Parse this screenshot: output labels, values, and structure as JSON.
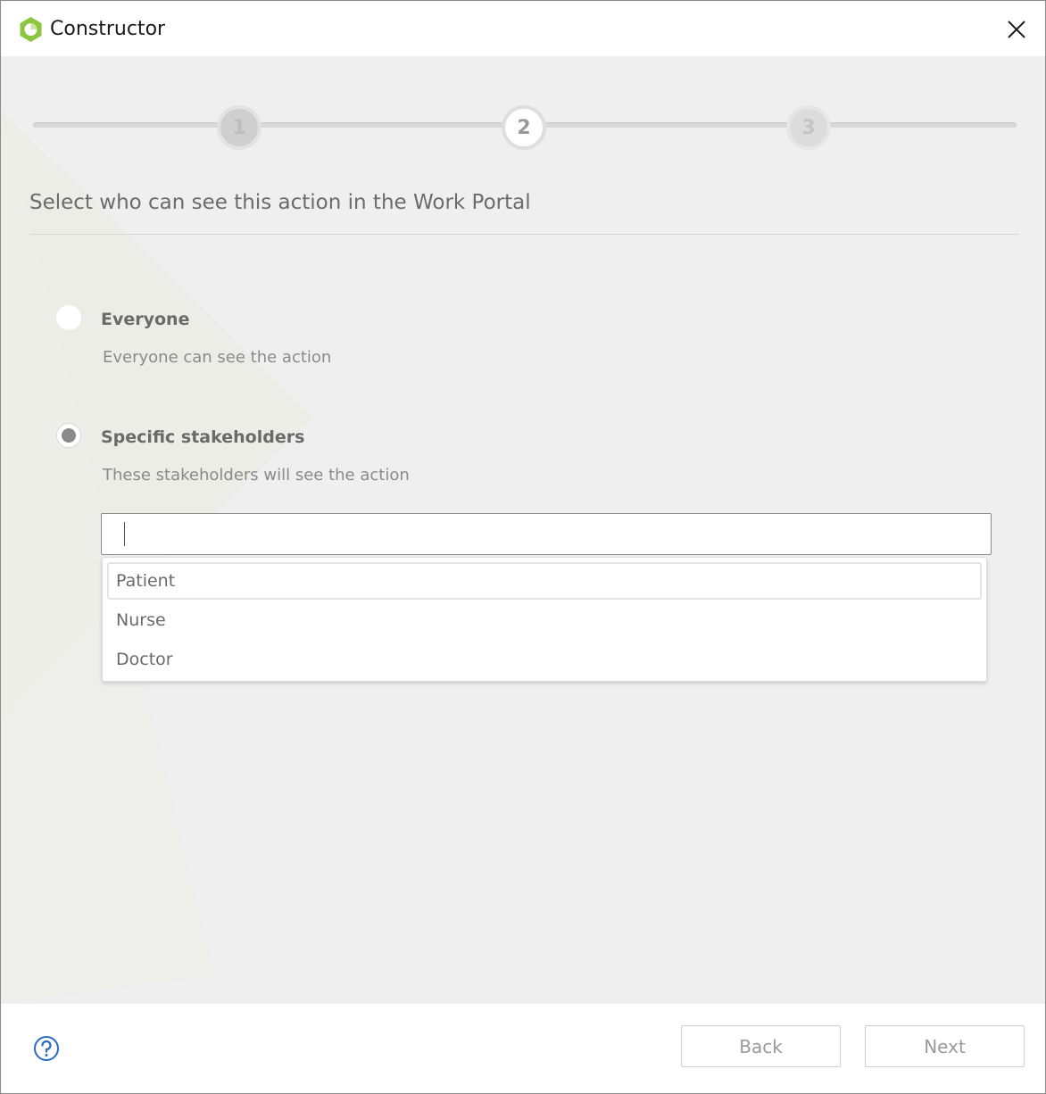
{
  "window": {
    "title": "Constructor"
  },
  "stepper": {
    "steps": [
      {
        "label": "1",
        "state": "completed"
      },
      {
        "label": "2",
        "state": "current"
      },
      {
        "label": "3",
        "state": "upcoming"
      }
    ]
  },
  "heading": "Select who can see this action in the Work Portal",
  "options": [
    {
      "title": "Everyone",
      "description": "Everyone can see the action",
      "selected": false
    },
    {
      "title": "Specific stakeholders",
      "description": "These stakeholders will see the action",
      "selected": true
    }
  ],
  "stakeholder_input": {
    "value": "",
    "placeholder": ""
  },
  "dropdown": {
    "items": [
      "Patient",
      "Nurse",
      "Doctor"
    ],
    "highlighted_index": 0
  },
  "footer": {
    "back_label": "Back",
    "next_label": "Next"
  },
  "colors": {
    "brand": "#8cc63f",
    "content_bg": "#efefef",
    "text_muted": "#8a8a8a"
  },
  "icons": {
    "app": "constructor-logo-icon",
    "close": "close-icon",
    "help": "help-icon"
  }
}
